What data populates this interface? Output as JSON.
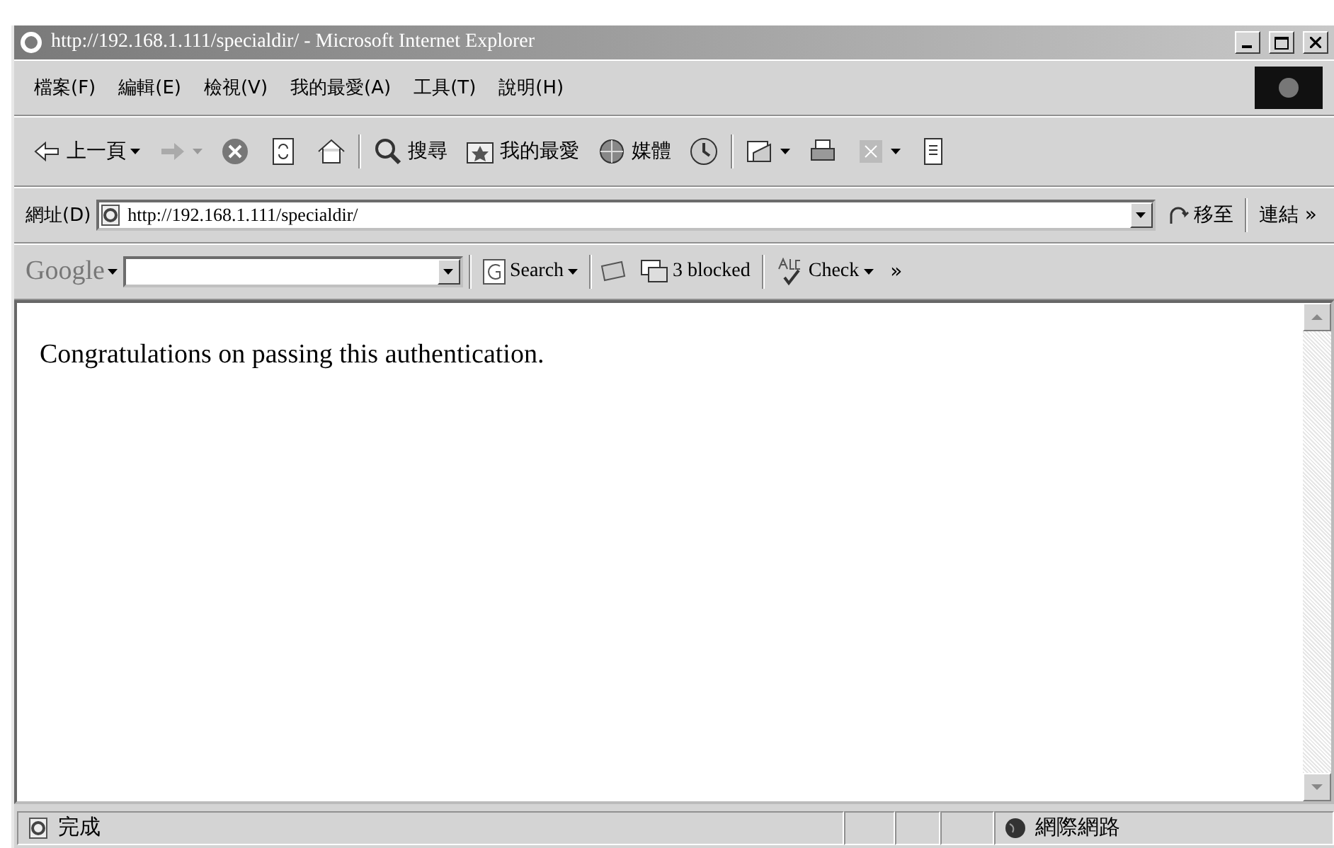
{
  "window": {
    "title": "http://192.168.1.111/specialdir/ - Microsoft Internet Explorer"
  },
  "menu": [
    "檔案(F)",
    "編輯(E)",
    "檢視(V)",
    "我的最愛(A)",
    "工具(T)",
    "說明(H)"
  ],
  "toolbar": [
    {
      "kind": "back",
      "label": "上一頁"
    },
    {
      "kind": "forward"
    },
    {
      "kind": "stop"
    },
    {
      "kind": "refresh"
    },
    {
      "kind": "home"
    },
    {
      "kind": "sep"
    },
    {
      "kind": "search",
      "label": "搜尋"
    },
    {
      "kind": "favorites",
      "label": "我的最愛"
    },
    {
      "kind": "media",
      "label": "媒體"
    },
    {
      "kind": "history"
    },
    {
      "kind": "sep"
    },
    {
      "kind": "mail"
    },
    {
      "kind": "print"
    },
    {
      "kind": "edit"
    },
    {
      "kind": "discuss"
    }
  ],
  "address": {
    "label": "網址(D)",
    "value": "http://192.168.1.111/specialdir/",
    "go": "移至",
    "links": "連結",
    "more": "»"
  },
  "google": {
    "logo": "Google",
    "search": "Search",
    "blocked": "3 blocked",
    "check": "Check",
    "more": "»"
  },
  "content": {
    "text": "Congratulations on passing this authentication."
  },
  "status_bar": {
    "text": "完成",
    "zone": "網際網路"
  }
}
